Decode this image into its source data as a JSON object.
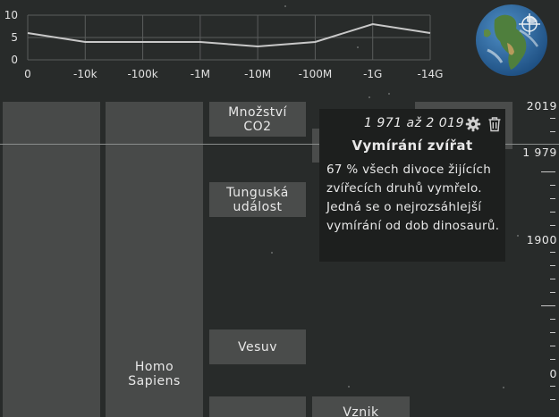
{
  "mini_chart": {
    "y_ticks": [
      "10",
      "5",
      "0"
    ],
    "x_ticks": [
      "0",
      "-10k",
      "-100k",
      "-1M",
      "-10M",
      "-100M",
      "-1G",
      "-14G"
    ],
    "values": [
      6,
      4,
      4,
      4,
      3,
      4,
      8,
      6
    ],
    "ylim": [
      0,
      10
    ],
    "line_color": "#c8c8c8",
    "grid_color": "#5a5d5c"
  },
  "columns": {
    "left": {
      "label": ""
    },
    "homo": {
      "label_line1": "Homo",
      "label_line2": "Sapiens"
    }
  },
  "events": {
    "co2": {
      "line1": "Množství",
      "line2": "CO2"
    },
    "tunguska": {
      "line1": "Tunguská",
      "line2": "událost"
    },
    "vesuv": {
      "line1": "Vesuv",
      "line2": ""
    },
    "vznik": {
      "line1": "Vznik",
      "line2": ""
    }
  },
  "popup": {
    "dates": "1 971 až 2 019",
    "title": "Vymírání zvířat",
    "description": "67 % všech divoce žijících zvířecích druhů vymřelo. Jedná se o nejrozsáhlejší vymírání od dob dinosaurů.",
    "settings_icon": "gear-icon",
    "delete_icon": "trash-icon"
  },
  "scale": {
    "labels": [
      "2019",
      "1 979",
      "1900",
      "0"
    ]
  },
  "globe": {
    "icon": "crosshair-icon"
  }
}
